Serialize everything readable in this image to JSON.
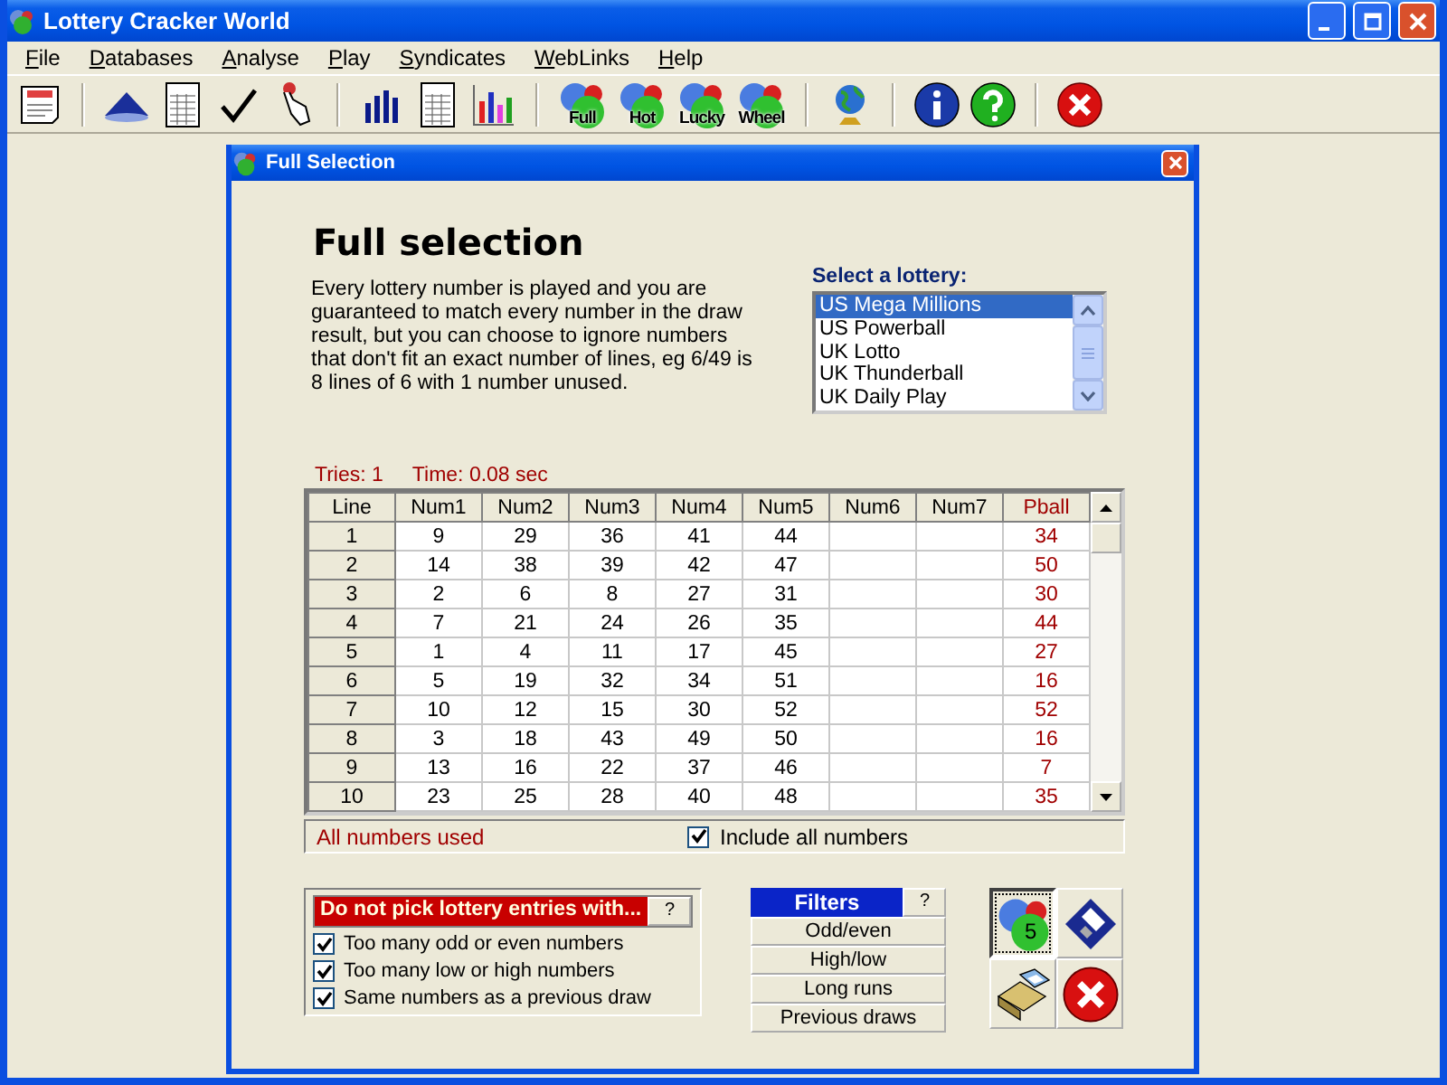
{
  "window": {
    "title": "Lottery Cracker World"
  },
  "menu": [
    "File",
    "Databases",
    "Analyse",
    "Play",
    "Syndicates",
    "WebLinks",
    "Help"
  ],
  "toolbar": [
    {
      "kind": "note"
    },
    {
      "kind": "separator"
    },
    {
      "kind": "pyramid"
    },
    {
      "kind": "sheet"
    },
    {
      "kind": "tick"
    },
    {
      "kind": "hand"
    },
    {
      "kind": "separator"
    },
    {
      "kind": "bars"
    },
    {
      "kind": "sheet"
    },
    {
      "kind": "colorbars"
    },
    {
      "kind": "separator"
    },
    {
      "kind": "balls",
      "label": "Full"
    },
    {
      "kind": "balls",
      "label": "Hot"
    },
    {
      "kind": "balls",
      "label": "Lucky"
    },
    {
      "kind": "balls",
      "label": "Wheel"
    },
    {
      "kind": "separator"
    },
    {
      "kind": "globe"
    },
    {
      "kind": "separator"
    },
    {
      "kind": "info"
    },
    {
      "kind": "help"
    },
    {
      "kind": "separator"
    },
    {
      "kind": "close"
    }
  ],
  "dialog": {
    "title": "Full Selection",
    "heading": "Full selection",
    "description": "Every lottery number is played and you are guaranteed to match every number in the draw result, but you can choose to ignore numbers that don't fit an exact number of lines, eg 6/49 is 8 lines of 6 with 1 number unused.",
    "lottery_label": "Select a lottery:",
    "lotteries": [
      {
        "label": "US Mega Millions",
        "selected": true
      },
      {
        "label": "US Powerball",
        "selected": false
      },
      {
        "label": "UK Lotto",
        "selected": false
      },
      {
        "label": "UK Thunderball",
        "selected": false
      },
      {
        "label": "UK Daily Play",
        "selected": false
      }
    ],
    "tries": "Tries: 1",
    "time": "Time: 0.08 sec",
    "table": {
      "columns": [
        {
          "label": "Line",
          "kind": "index"
        },
        {
          "label": "Num1",
          "kind": "number"
        },
        {
          "label": "Num2",
          "kind": "number"
        },
        {
          "label": "Num3",
          "kind": "number"
        },
        {
          "label": "Num4",
          "kind": "number"
        },
        {
          "label": "Num5",
          "kind": "number"
        },
        {
          "label": "Num6",
          "kind": "number"
        },
        {
          "label": "Num7",
          "kind": "number"
        },
        {
          "label": "Pball",
          "kind": "bonus"
        }
      ],
      "rows": [
        {
          "line": "1",
          "numbers": [
            "9",
            "29",
            "36",
            "41",
            "44"
          ],
          "bonus": "34"
        },
        {
          "line": "2",
          "numbers": [
            "14",
            "38",
            "39",
            "42",
            "47"
          ],
          "bonus": "50"
        },
        {
          "line": "3",
          "numbers": [
            "2",
            "6",
            "8",
            "27",
            "31"
          ],
          "bonus": "30"
        },
        {
          "line": "4",
          "numbers": [
            "7",
            "21",
            "24",
            "26",
            "35"
          ],
          "bonus": "44"
        },
        {
          "line": "5",
          "numbers": [
            "1",
            "4",
            "11",
            "17",
            "45"
          ],
          "bonus": "27"
        },
        {
          "line": "6",
          "numbers": [
            "5",
            "19",
            "32",
            "34",
            "51"
          ],
          "bonus": "16"
        },
        {
          "line": "7",
          "numbers": [
            "10",
            "12",
            "15",
            "30",
            "52"
          ],
          "bonus": "52"
        },
        {
          "line": "8",
          "numbers": [
            "3",
            "18",
            "43",
            "49",
            "50"
          ],
          "bonus": "16"
        },
        {
          "line": "9",
          "numbers": [
            "13",
            "16",
            "22",
            "37",
            "46"
          ],
          "bonus": "7"
        },
        {
          "line": "10",
          "numbers": [
            "23",
            "25",
            "28",
            "40",
            "48"
          ],
          "bonus": "35"
        }
      ]
    },
    "status": "All numbers used",
    "include_all": {
      "label": "Include all numbers",
      "checked": true
    },
    "exclude_panel": {
      "title": "Do not pick lottery entries with...",
      "help": "?",
      "options": [
        {
          "label": "Too many odd or even numbers",
          "checked": true
        },
        {
          "label": "Too many low or high numbers",
          "checked": true
        },
        {
          "label": "Same numbers as a previous draw",
          "checked": true
        }
      ]
    },
    "filters": {
      "title": "Filters",
      "help": "?",
      "items": [
        "Odd/even",
        "High/low",
        "Long runs",
        "Previous draws"
      ]
    },
    "actions": [
      {
        "kind": "balls",
        "badge": "5",
        "selected": true
      },
      {
        "kind": "save",
        "selected": false
      },
      {
        "kind": "print",
        "selected": false
      },
      {
        "kind": "close",
        "selected": false
      }
    ]
  }
}
